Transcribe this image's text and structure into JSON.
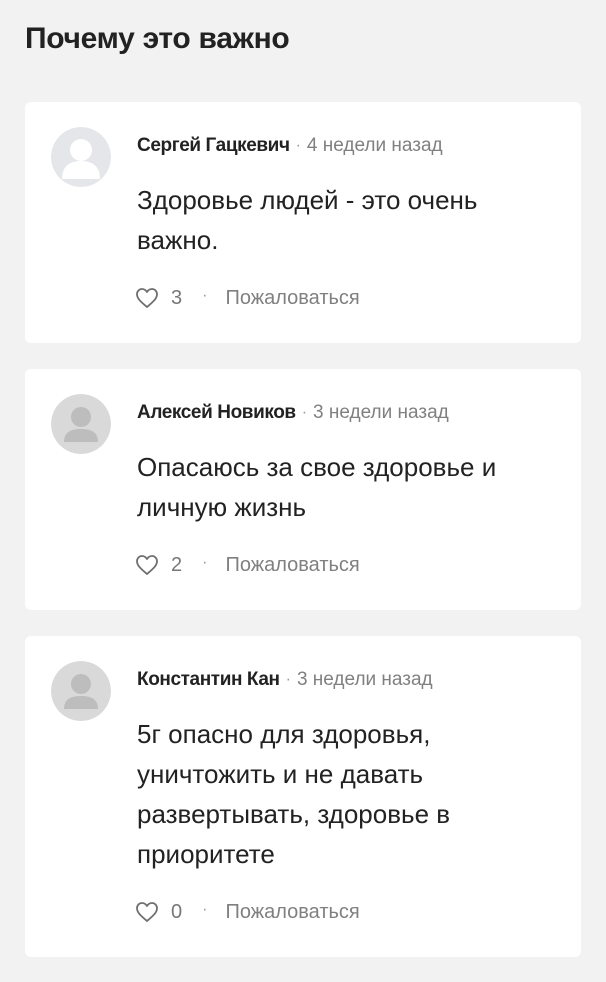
{
  "section": {
    "title": "Почему это важно"
  },
  "comments": [
    {
      "author": "Сергей Гацкевич",
      "time": "4 недели назад",
      "text": "Здоровье людей - это очень важно.",
      "likes": "3",
      "report_label": "Пожаловаться",
      "avatar": "generic-avatar-light"
    },
    {
      "author": "Алексей Новиков",
      "time": "3 недели назад",
      "text": "Опасаюсь за свое здоровье и личную жизнь",
      "likes": "2",
      "report_label": "Пожаловаться",
      "avatar": "generic-avatar-gray"
    },
    {
      "author": "Константин Кан",
      "time": "3 недели назад",
      "text": "5г опасно для здоровья, уничтожить и не давать развертывать, здоровье в приоритете",
      "likes": "0",
      "report_label": "Пожаловаться",
      "avatar": "generic-avatar-gray"
    }
  ],
  "icons": {
    "like": "heart-outline-icon"
  },
  "colors": {
    "page_background": "#f2f2f2",
    "card_background": "#ffffff",
    "text_primary": "#222222",
    "text_secondary": "#808080"
  }
}
